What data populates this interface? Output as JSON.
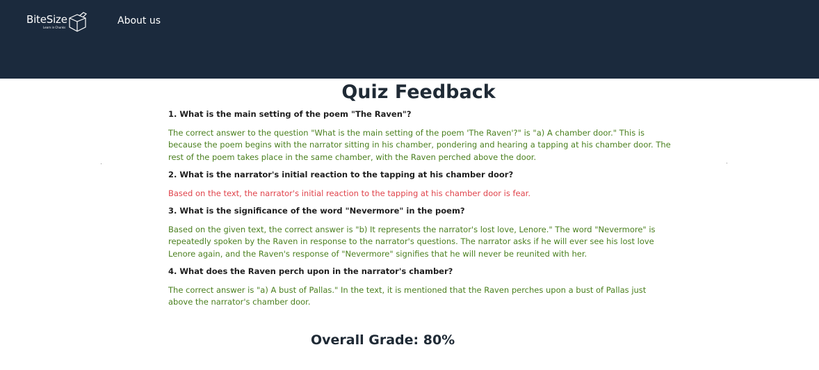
{
  "header": {
    "logo_text": "BiteSize",
    "logo_tagline": "Learn in Chunks",
    "nav": {
      "about_label": "About us"
    }
  },
  "page": {
    "title": "Quiz Feedback"
  },
  "questions": [
    {
      "question": "1. What is the main setting of the poem \"The Raven\"?",
      "feedback": "The correct answer to the question \"What is the main setting of the poem 'The Raven'?\" is \"a) A chamber door.\" This is because the poem begins with the narrator sitting in his chamber, pondering and hearing a tapping at his chamber door. The rest of the poem takes place in the same chamber, with the Raven perched above the door.",
      "status": "correct"
    },
    {
      "question": "2. What is the narrator's initial reaction to the tapping at his chamber door?",
      "feedback": "Based on the text, the narrator's initial reaction to the tapping at his chamber door is fear.",
      "status": "incorrect"
    },
    {
      "question": "3. What is the significance of the word \"Nevermore\" in the poem?",
      "feedback": "Based on the given text, the correct answer is \"b) It represents the narrator's lost love, Lenore.\" The word \"Nevermore\" is repeatedly spoken by the Raven in response to the narrator's questions. The narrator asks if he will ever see his lost love Lenore again, and the Raven's response of \"Nevermore\" signifies that he will never be reunited with her.",
      "status": "correct"
    },
    {
      "question": "4. What does the Raven perch upon in the narrator's chamber?",
      "feedback": "The correct answer is \"a) A bust of Pallas.\" In the text, it is mentioned that the Raven perches upon a bust of Pallas just above the narrator's chamber door.",
      "status": "correct"
    }
  ],
  "summary": {
    "grade_text": "Overall Grade: 80%"
  },
  "colors": {
    "header_bg": "#1b2a3d",
    "correct": "#4a7f1e",
    "incorrect": "#e0434b"
  }
}
